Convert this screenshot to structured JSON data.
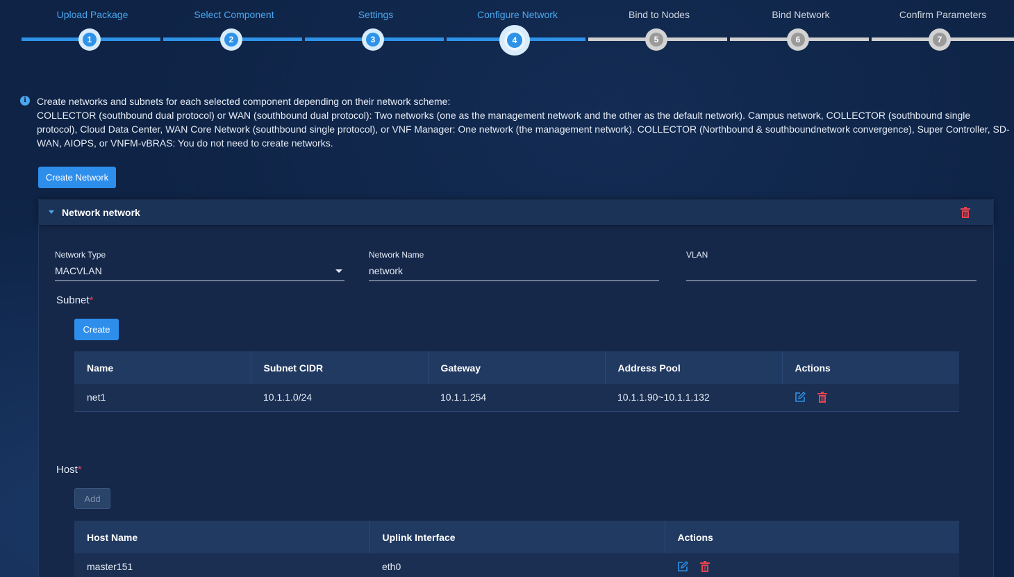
{
  "stepper": {
    "steps": [
      {
        "num": "1",
        "label": "Upload Package"
      },
      {
        "num": "2",
        "label": "Select Component"
      },
      {
        "num": "3",
        "label": "Settings"
      },
      {
        "num": "4",
        "label": "Configure Network"
      },
      {
        "num": "5",
        "label": "Bind to Nodes"
      },
      {
        "num": "6",
        "label": "Bind Network"
      },
      {
        "num": "7",
        "label": "Confirm Parameters"
      }
    ],
    "current_step": 4
  },
  "info": {
    "title": "Create networks and subnets for each selected component depending on their network scheme:",
    "body": "COLLECTOR (southbound dual protocol) or WAN (southbound dual protocol): Two networks (one as the management network and the other as the default network). Campus network, COLLECTOR (southbound single protocol), Cloud Data Center, WAN Core Network (southbound single protocol), or VNF Manager: One network (the management network). COLLECTOR (Northbound & southboundnetwork convergence), Super Controller, SD-WAN, AIOPS, or VNFM-vBRAS: You do not need to create networks."
  },
  "create_network_label": "Create Network",
  "panel": {
    "title": "Network network",
    "fields": {
      "network_type_label": "Network Type",
      "network_type_value": "MACVLAN",
      "network_name_label": "Network Name",
      "network_name_value": "network",
      "vlan_label": "VLAN",
      "vlan_value": ""
    },
    "subnet": {
      "label": "Subnet",
      "required_mark": "*",
      "create_label": "Create",
      "columns": [
        "Name",
        "Subnet CIDR",
        "Gateway",
        "Address Pool",
        "Actions"
      ],
      "rows": [
        {
          "name": "net1",
          "cidr": "10.1.1.0/24",
          "gateway": "10.1.1.254",
          "pool": "10.1.1.90~10.1.1.132"
        }
      ]
    },
    "host": {
      "label": "Host",
      "required_mark": "*",
      "add_label": "Add",
      "columns": [
        "Host Name",
        "Uplink Interface",
        "Actions"
      ],
      "rows": [
        {
          "host": "master151",
          "uplink": "eth0"
        }
      ]
    }
  },
  "colors": {
    "accent": "#2e8eec",
    "danger": "#e8434f",
    "background": "#0e2345"
  }
}
